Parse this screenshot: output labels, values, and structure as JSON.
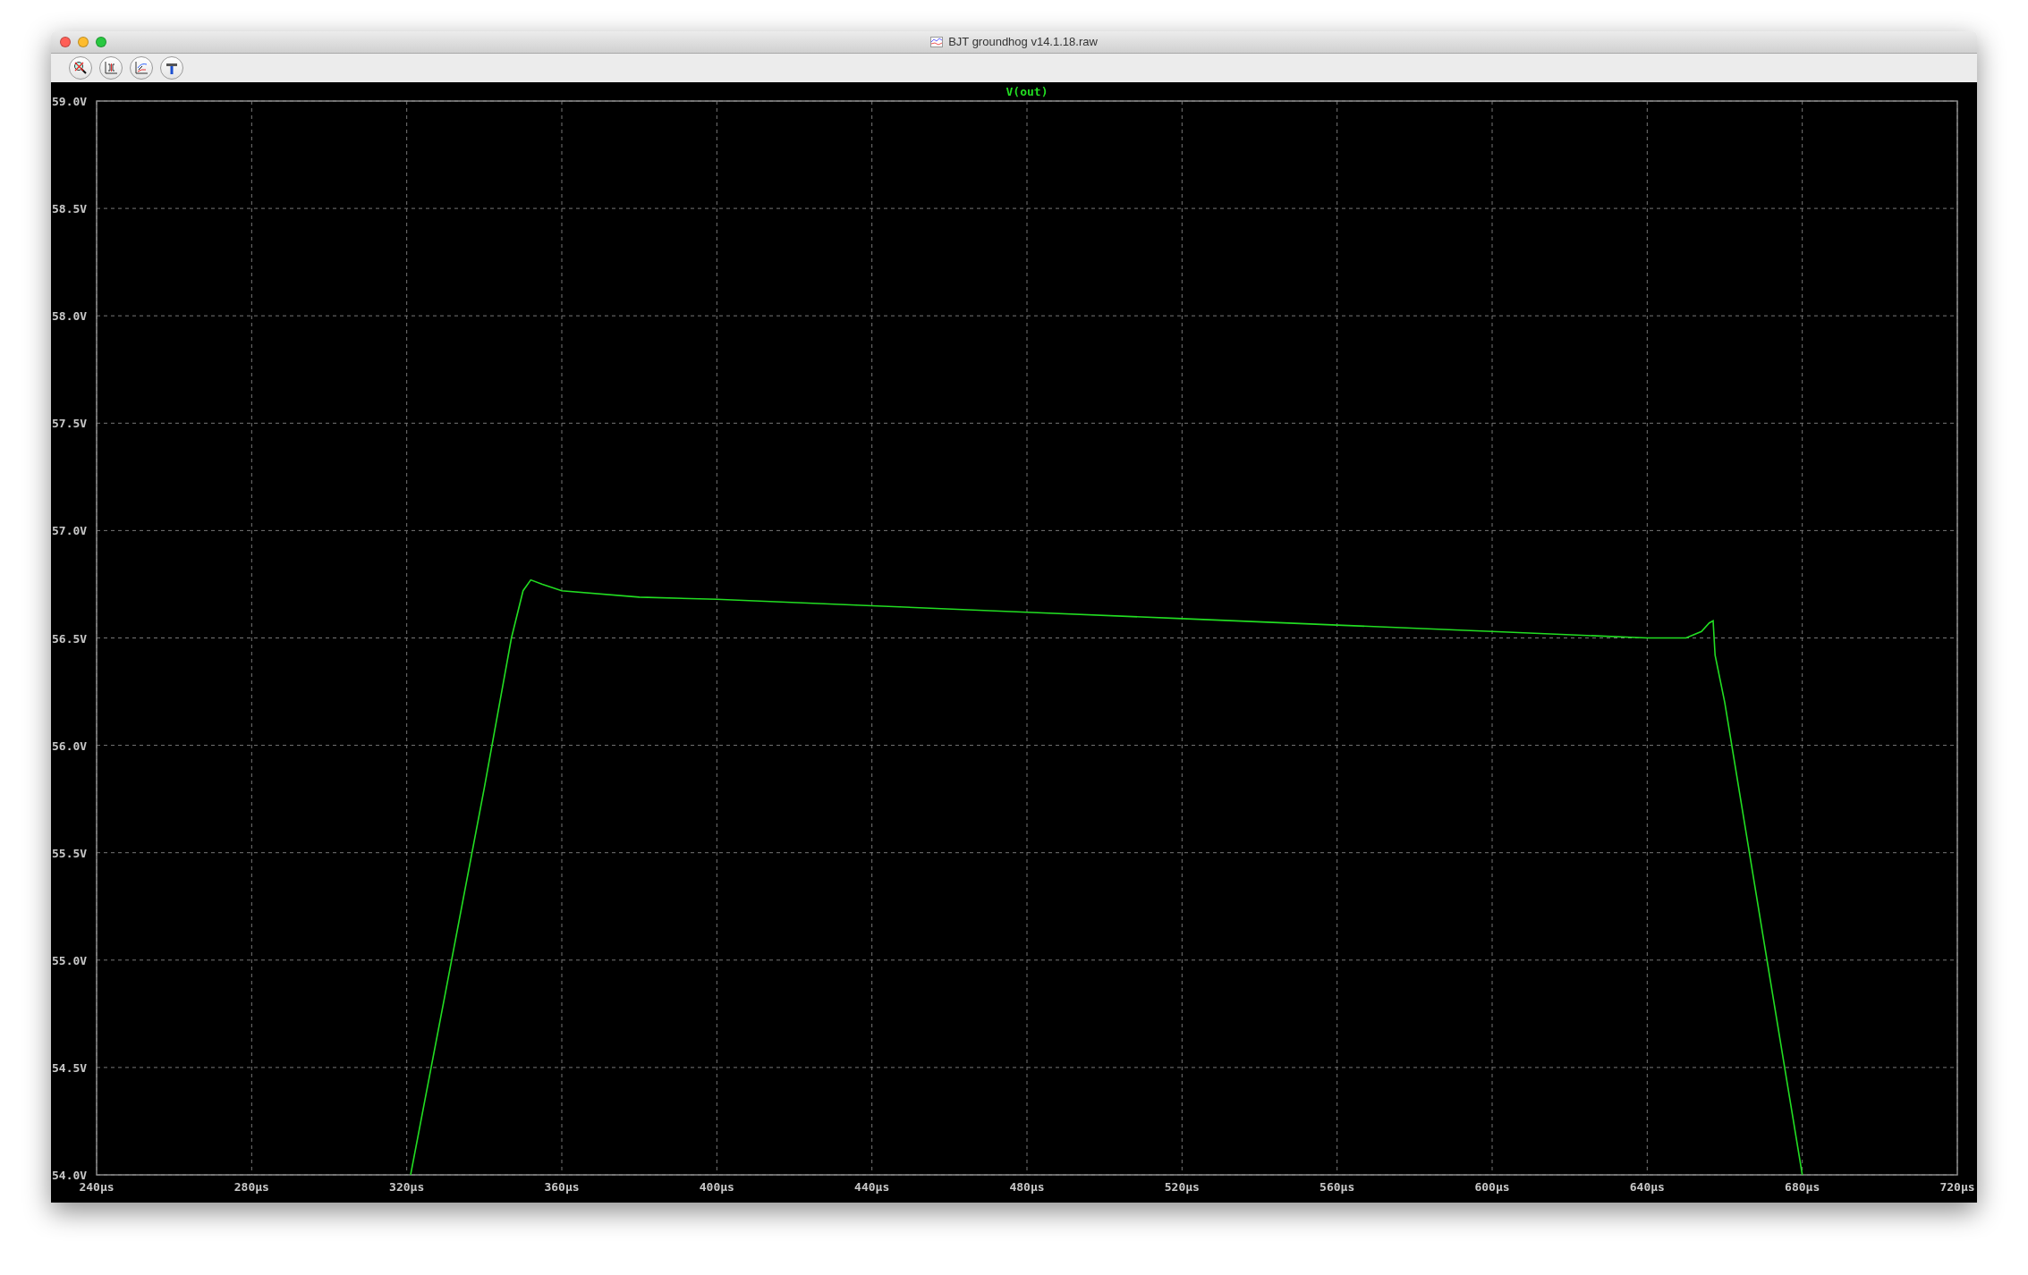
{
  "window": {
    "title": "BJT groundhog v14.1.18.raw"
  },
  "plot": {
    "chart_data": {
      "type": "line",
      "grid": true,
      "xlim": [
        240,
        720
      ],
      "ylim": [
        54,
        59
      ],
      "xticks": [
        {
          "value": 240,
          "label": "240µs"
        },
        {
          "value": 280,
          "label": "280µs"
        },
        {
          "value": 320,
          "label": "320µs"
        },
        {
          "value": 360,
          "label": "360µs"
        },
        {
          "value": 400,
          "label": "400µs"
        },
        {
          "value": 440,
          "label": "440µs"
        },
        {
          "value": 480,
          "label": "480µs"
        },
        {
          "value": 520,
          "label": "520µs"
        },
        {
          "value": 560,
          "label": "560µs"
        },
        {
          "value": 600,
          "label": "600µs"
        },
        {
          "value": 640,
          "label": "640µs"
        },
        {
          "value": 680,
          "label": "680µs"
        },
        {
          "value": 720,
          "label": "720µs"
        }
      ],
      "yticks": [
        {
          "value": 59,
          "label": "59.0V"
        },
        {
          "value": 58.5,
          "label": "58.5V"
        },
        {
          "value": 58,
          "label": "58.0V"
        },
        {
          "value": 57.5,
          "label": "57.5V"
        },
        {
          "value": 57,
          "label": "57.0V"
        },
        {
          "value": 56.5,
          "label": "56.5V"
        },
        {
          "value": 56,
          "label": "56.0V"
        },
        {
          "value": 55.5,
          "label": "55.5V"
        },
        {
          "value": 55,
          "label": "55.0V"
        },
        {
          "value": 54.5,
          "label": "54.5V"
        },
        {
          "value": 54,
          "label": "54.0V"
        }
      ],
      "x": [
        321,
        330,
        340,
        347,
        350,
        352,
        355,
        360,
        380,
        400,
        440,
        480,
        520,
        560,
        600,
        640,
        650,
        654,
        656,
        657,
        657.5,
        660,
        670,
        680
      ],
      "series": [
        {
          "name": "V(out)",
          "color": "#22dd22",
          "values": [
            54.0,
            54.85,
            55.8,
            56.5,
            56.72,
            56.77,
            56.75,
            56.72,
            56.69,
            56.68,
            56.65,
            56.62,
            56.59,
            56.56,
            56.53,
            56.5,
            56.5,
            56.53,
            56.57,
            56.58,
            56.42,
            56.2,
            55.1,
            54.0
          ]
        }
      ]
    }
  }
}
